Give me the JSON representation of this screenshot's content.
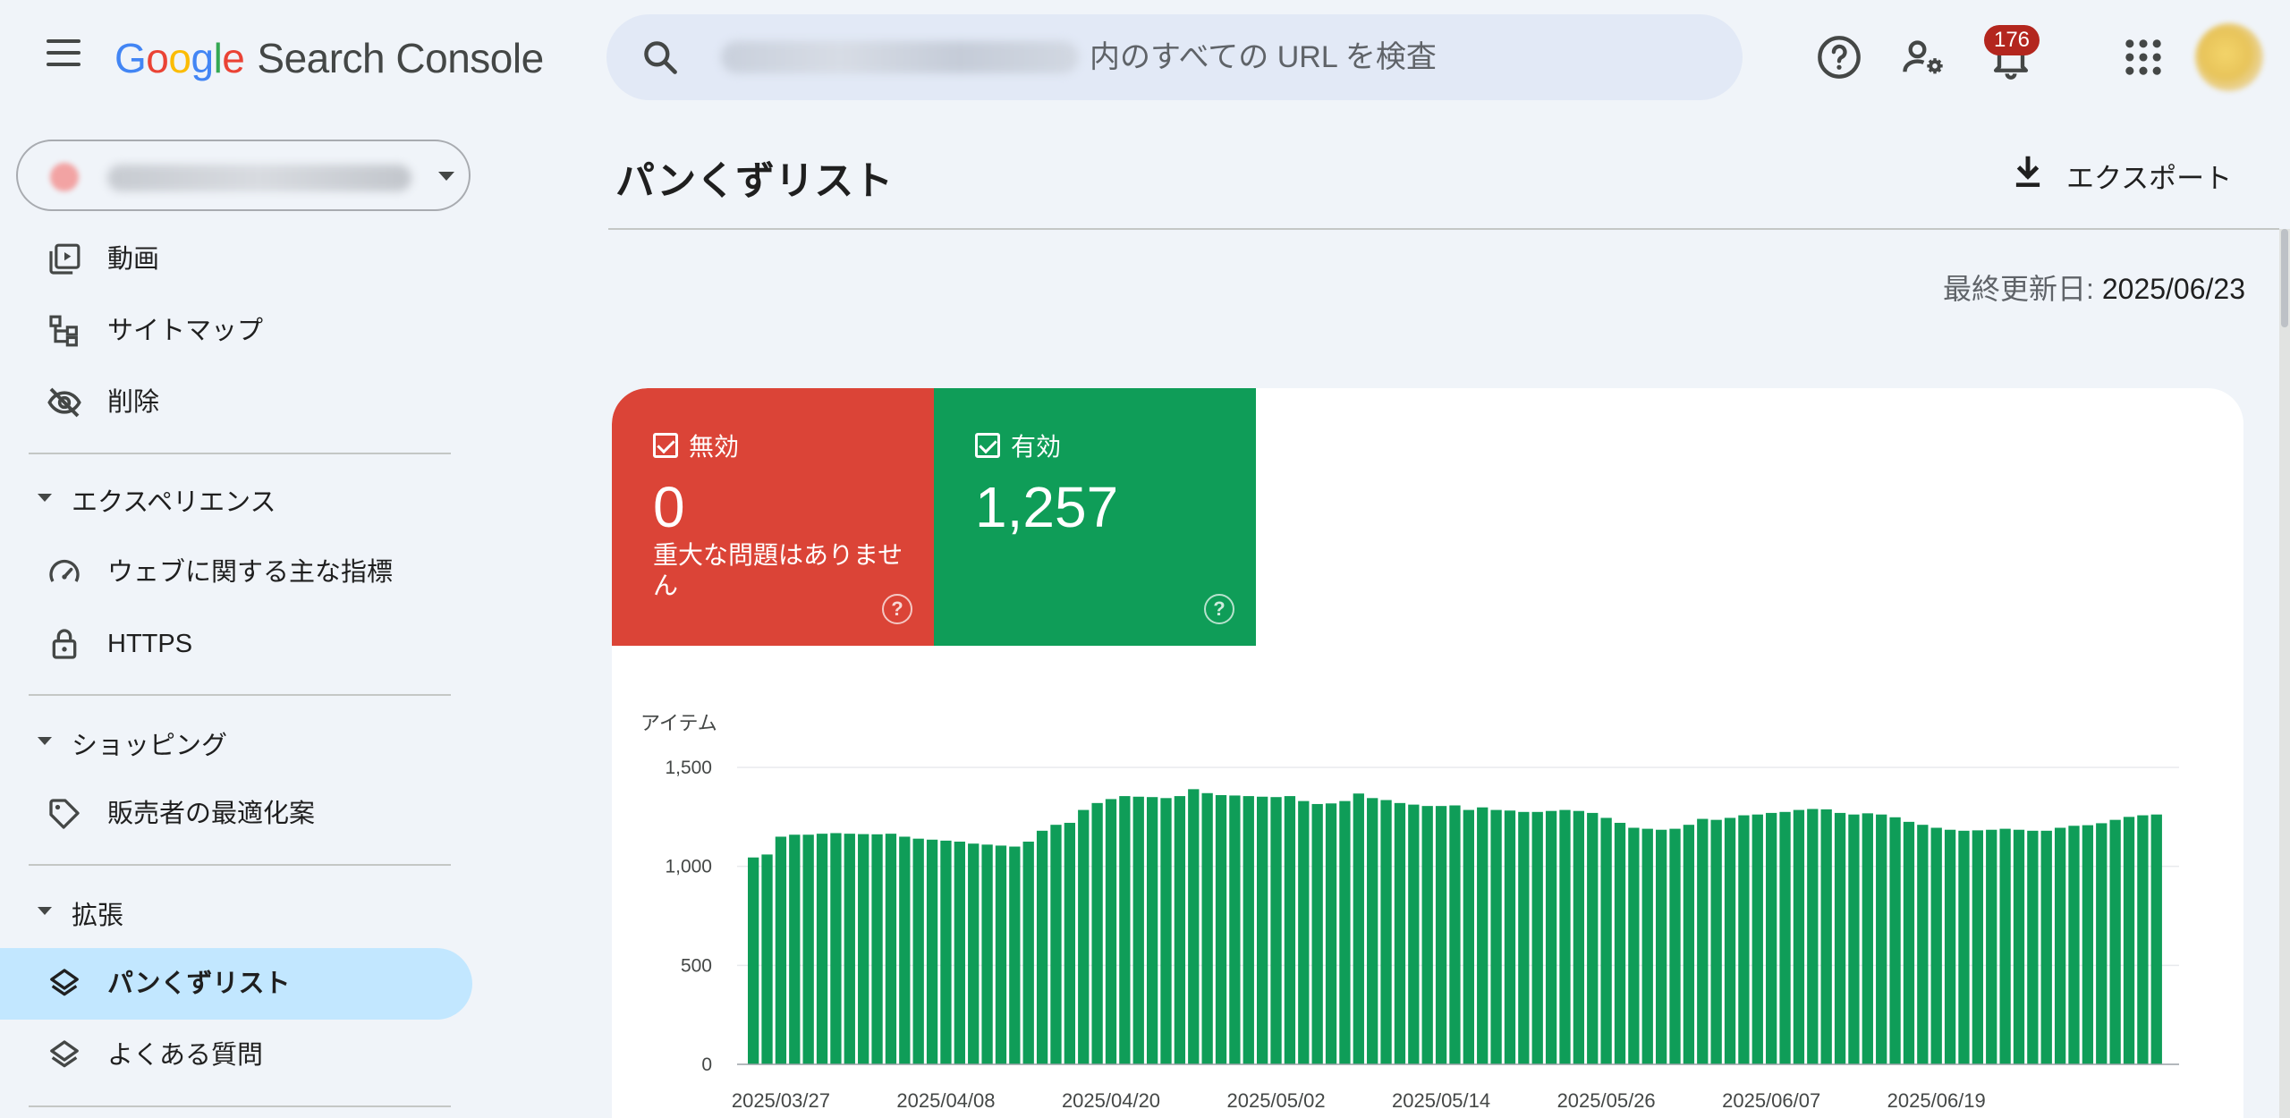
{
  "header": {
    "logo": {
      "g1": "G",
      "g2": "o",
      "g3": "o",
      "g4": "g",
      "g5": "l",
      "g6": "e",
      "product": "Search Console"
    },
    "search_placeholder": "内のすべての URL を検査",
    "notification_count": "176"
  },
  "sidebar": {
    "items_top": [
      {
        "label": "動画",
        "icon": "video-library-icon"
      },
      {
        "label": "サイトマップ",
        "icon": "sitemap-icon"
      },
      {
        "label": "削除",
        "icon": "visibility-off-icon"
      }
    ],
    "sections": [
      {
        "label": "エクスペリエンス",
        "items": [
          {
            "label": "ウェブに関する主な指標",
            "icon": "speed-gauge-icon"
          },
          {
            "label": "HTTPS",
            "icon": "lock-icon"
          }
        ]
      },
      {
        "label": "ショッピング",
        "items": [
          {
            "label": "販売者の最適化案",
            "icon": "tag-icon"
          }
        ]
      },
      {
        "label": "拡張",
        "items": [
          {
            "label": "パンくずリスト",
            "icon": "layers-icon",
            "active": true
          },
          {
            "label": "よくある質問",
            "icon": "layers-icon"
          }
        ]
      }
    ]
  },
  "main": {
    "title": "パンくずリスト",
    "export_label": "エクスポート",
    "last_updated_label": "最終更新日: ",
    "last_updated_value": "2025/06/23",
    "tiles": {
      "invalid": {
        "label": "無効",
        "value": "0",
        "sub": "重大な問題はありません"
      },
      "valid": {
        "label": "有効",
        "value": "1,257"
      }
    }
  },
  "colors": {
    "invalid": "#db4437",
    "valid": "#0f9d58",
    "active_nav": "#c2e7ff",
    "background": "#f0f4f9"
  },
  "chart_data": {
    "type": "bar",
    "ylabel": "アイテム",
    "ylim": [
      0,
      1500
    ],
    "yticks": [
      0,
      500,
      1000,
      1500
    ],
    "ytick_labels": [
      "0",
      "500",
      "1,000",
      "1,500"
    ],
    "xtick_labels": [
      "2025/03/27",
      "2025/04/08",
      "2025/04/20",
      "2025/05/02",
      "2025/05/14",
      "2025/05/26",
      "2025/06/07",
      "2025/06/19"
    ],
    "xtick_indices": [
      2,
      14,
      26,
      38,
      50,
      62,
      74,
      86
    ],
    "series": [
      {
        "color": "#0f9d58",
        "values": [
          1045,
          1060,
          1150,
          1160,
          1160,
          1165,
          1168,
          1165,
          1163,
          1162,
          1165,
          1150,
          1140,
          1135,
          1130,
          1125,
          1115,
          1110,
          1105,
          1100,
          1125,
          1180,
          1210,
          1220,
          1285,
          1320,
          1340,
          1355,
          1352,
          1350,
          1345,
          1355,
          1390,
          1370,
          1360,
          1358,
          1355,
          1352,
          1350,
          1355,
          1330,
          1315,
          1318,
          1330,
          1368,
          1345,
          1335,
          1320,
          1312,
          1305,
          1305,
          1308,
          1285,
          1298,
          1285,
          1282,
          1275,
          1275,
          1280,
          1285,
          1280,
          1270,
          1245,
          1220,
          1195,
          1190,
          1185,
          1190,
          1210,
          1240,
          1235,
          1245,
          1258,
          1262,
          1270,
          1275,
          1285,
          1290,
          1288,
          1270,
          1262,
          1268,
          1262,
          1248,
          1225,
          1210,
          1195,
          1185,
          1180,
          1182,
          1185,
          1190,
          1185,
          1180,
          1180,
          1195,
          1205,
          1208,
          1218,
          1235,
          1250,
          1258,
          1262
        ]
      }
    ]
  }
}
